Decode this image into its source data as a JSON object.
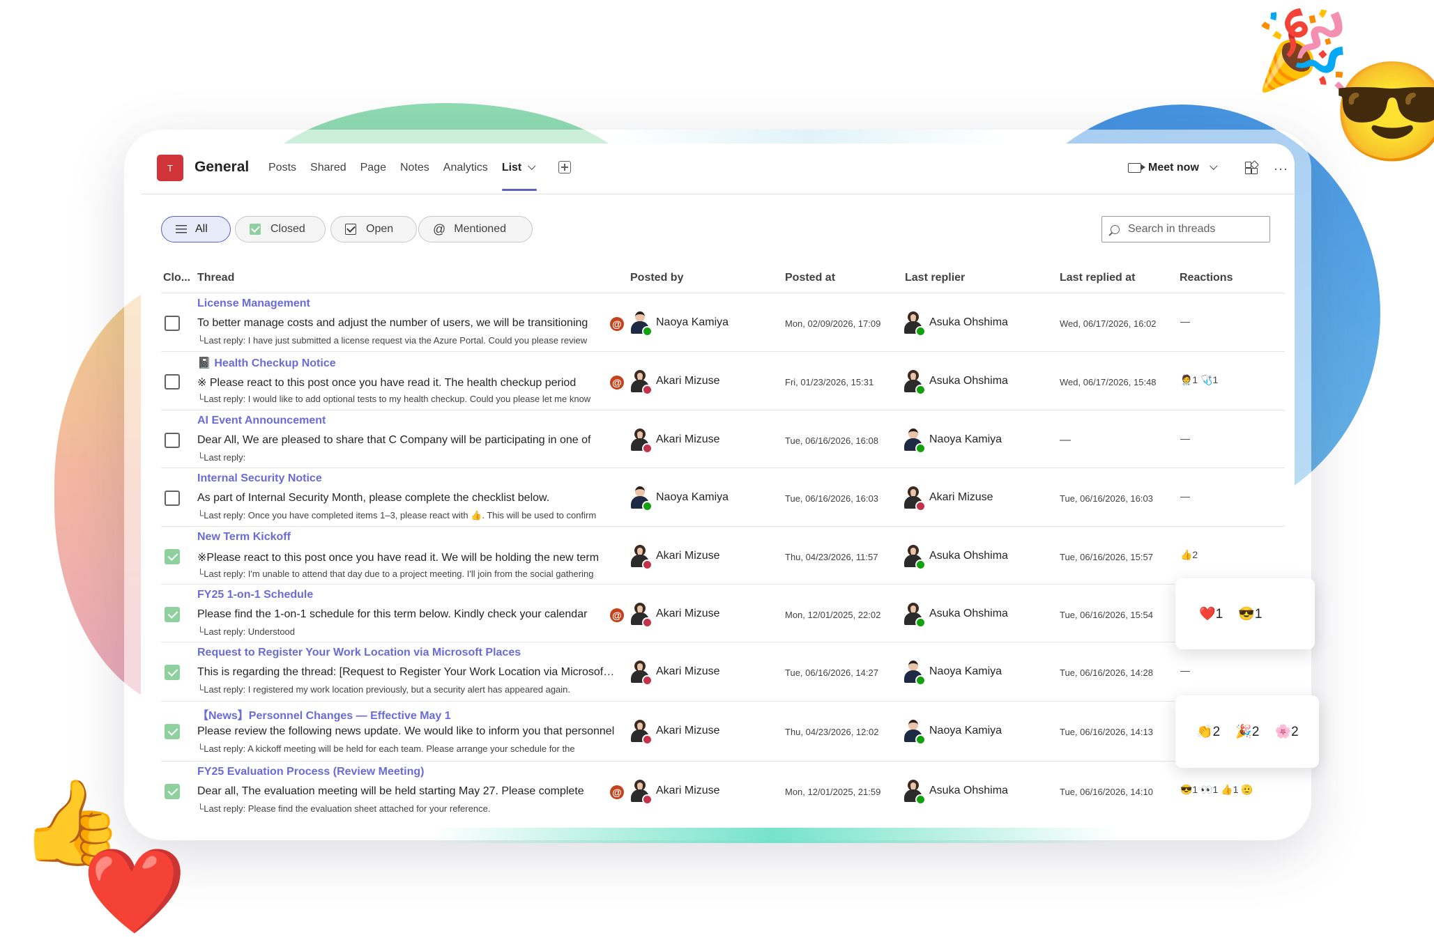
{
  "channel": {
    "team_initial": "T",
    "name": "General"
  },
  "tabs": [
    "Posts",
    "Shared",
    "Page",
    "Notes",
    "Analytics",
    "List"
  ],
  "header": {
    "meet_now": "Meet now",
    "more": "···"
  },
  "filters": [
    "All",
    "Closed",
    "Open",
    "Mentioned"
  ],
  "search": {
    "placeholder": "Search in threads"
  },
  "columns": [
    "Clo...",
    "Thread",
    "Posted by",
    "Posted at",
    "Last replier",
    "Last replied at",
    "Reactions"
  ],
  "rows": [
    {
      "closed": false,
      "title": "License Management",
      "body": "To better manage costs and adjust the number of users, we will be transitioning",
      "mention": true,
      "last_reply": "└Last reply: I have just submitted a license request via the Azure Portal. Could you please review",
      "posted_by": "Naoya Kamiya",
      "posted_by_status": "available",
      "posted_at": "Mon, 02/09/2026, 17:09",
      "last_replier": "Asuka Ohshima",
      "last_replier_status": "available",
      "last_replied_at": "Wed, 06/17/2026, 16:02",
      "reactions": "—"
    },
    {
      "closed": false,
      "title": "📓 Health Checkup Notice",
      "body": "※ Please react to this post once you have read it. The health checkup period",
      "mention": true,
      "last_reply": "└Last reply: I would like to add optional tests to my health checkup. Could you please let me know",
      "posted_by": "Akari Mizuse",
      "posted_by_status": "busy",
      "posted_at": "Fri, 01/23/2026, 15:31",
      "last_replier": "Asuka Ohshima",
      "last_replier_status": "available",
      "last_replied_at": "Wed, 06/17/2026, 15:48",
      "reactions": "🧑‍⚕️1   🩺1"
    },
    {
      "closed": false,
      "title": "AI Event Announcement",
      "body": "Dear All, We are pleased to share that C Company will be participating in one of",
      "mention": false,
      "last_reply": "└Last reply:",
      "posted_by": "Akari Mizuse",
      "posted_by_status": "busy",
      "posted_at": "Tue, 06/16/2026, 16:08",
      "last_replier": "Naoya Kamiya",
      "last_replier_status": "available",
      "last_replied_at": "—",
      "reactions": "—"
    },
    {
      "closed": false,
      "title": "Internal Security Notice",
      "body": "As part of Internal Security Month, please complete the checklist below.",
      "mention": false,
      "last_reply": "└Last reply: Once you have completed items 1–3, please react with 👍. This will be used to confirm",
      "posted_by": "Naoya Kamiya",
      "posted_by_status": "available",
      "posted_at": "Tue, 06/16/2026, 16:03",
      "last_replier": "Akari Mizuse",
      "last_replier_status": "busy",
      "last_replied_at": "Tue, 06/16/2026, 16:03",
      "reactions": "—"
    },
    {
      "closed": true,
      "title": "New Term Kickoff",
      "body": "※Please react to this post once you have read it.   We will be holding the new term",
      "mention": false,
      "last_reply": "└Last reply: I'm unable to attend that day due to a project meeting. I'll join from the social gathering",
      "posted_by": "Akari Mizuse",
      "posted_by_status": "busy",
      "posted_at": "Thu, 04/23/2026, 11:57",
      "last_replier": "Asuka Ohshima",
      "last_replier_status": "available",
      "last_replied_at": "Tue, 06/16/2026, 15:57",
      "reactions": "👍2"
    },
    {
      "closed": true,
      "title": "FY25 1-on-1 Schedule",
      "body": "Please find the 1-on-1 schedule for this term below. Kindly check your calendar",
      "mention": true,
      "last_reply": "└Last reply: Understood",
      "posted_by": "Akari Mizuse",
      "posted_by_status": "busy",
      "posted_at": "Mon, 12/01/2025, 22:02",
      "last_replier": "Asuka Ohshima",
      "last_replier_status": "available",
      "last_replied_at": "Tue, 06/16/2026, 15:54",
      "reactions": ""
    },
    {
      "closed": true,
      "title": "Request to Register Your Work Location via Microsoft Places",
      "body": "This is regarding the thread: [Request to Register Your Work Location via Microsoft Places]",
      "mention": false,
      "last_reply": "└Last reply: I registered my work location previously, but a security alert has appeared again.",
      "posted_by": "Akari Mizuse",
      "posted_by_status": "busy",
      "posted_at": "Tue, 06/16/2026, 14:27",
      "last_replier": "Naoya Kamiya",
      "last_replier_status": "available",
      "last_replied_at": "Tue, 06/16/2026, 14:28",
      "reactions": "—"
    },
    {
      "closed": true,
      "title": "【News】Personnel Changes — Effective May 1",
      "body": "Please review the following news update. We would like to inform you that personnel",
      "mention": false,
      "last_reply": "└Last reply: A kickoff meeting will be held for each team. Please arrange your schedule for the",
      "posted_by": "Akari Mizuse",
      "posted_by_status": "busy",
      "posted_at": "Thu, 04/23/2026, 12:02",
      "last_replier": "Naoya Kamiya",
      "last_replier_status": "available",
      "last_replied_at": "Tue, 06/16/2026, 14:13",
      "reactions": ""
    },
    {
      "closed": true,
      "title": "FY25 Evaluation Process (Review Meeting)",
      "body": "Dear all, The evaluation meeting will be held starting May 27. Please complete",
      "mention": true,
      "last_reply": "└Last reply: Please find the evaluation sheet attached for your reference.",
      "posted_by": "Akari Mizuse",
      "posted_by_status": "busy",
      "posted_at": "Mon, 12/01/2025, 21:59",
      "last_replier": "Asuka Ohshima",
      "last_replier_status": "available",
      "last_replied_at": "Tue, 06/16/2026, 14:10",
      "reactions": "😎1   👀1   👍1   🫡"
    }
  ],
  "reaction_popups": [
    {
      "items": [
        "❤️1",
        "😎1"
      ]
    },
    {
      "items": [
        "👏2",
        "🎉2",
        "🌸2"
      ]
    }
  ],
  "decorations": {
    "party": "🎉",
    "sunglasses": "😎",
    "thumbs_up": "👍",
    "heart": "❤️"
  },
  "colors": {
    "accent": "#5b5fc7",
    "thread_title": "#6a6cd6",
    "closed_check": "#8fd19e",
    "available": "#13a10e",
    "busy": "#c4314b",
    "team_avatar": "#d13438"
  }
}
